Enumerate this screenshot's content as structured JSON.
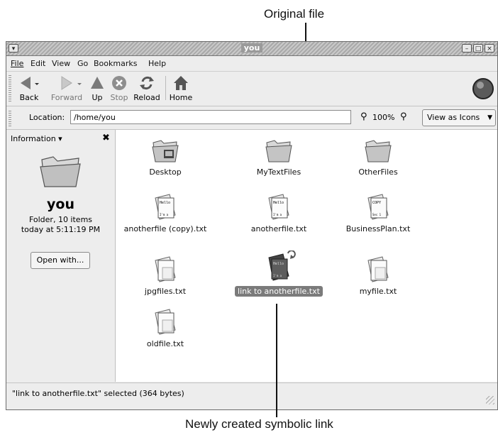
{
  "annotations": {
    "original_file": "Original file",
    "symbolic_link": "Newly created symbolic link"
  },
  "window": {
    "title": "you"
  },
  "menu": [
    "File",
    "Edit",
    "View",
    "Go",
    "Bookmarks",
    "Help"
  ],
  "toolbar": {
    "back": "Back",
    "forward": "Forward",
    "up": "Up",
    "stop": "Stop",
    "reload": "Reload",
    "home": "Home"
  },
  "location": {
    "label": "Location:",
    "value": "/home/you",
    "zoom": "100%",
    "view_mode": "View as Icons"
  },
  "sidebar": {
    "header": "Information",
    "folder_name": "you",
    "folder_info": "Folder, 10 items",
    "modified": "today at 5:11:19 PM",
    "open_with": "Open with..."
  },
  "files": [
    {
      "name": "Desktop",
      "kind": "folder-desktop"
    },
    {
      "name": "MyTextFiles",
      "kind": "folder"
    },
    {
      "name": "OtherFiles",
      "kind": "folder"
    },
    {
      "name": "anotherfile (copy).txt",
      "kind": "text-hello"
    },
    {
      "name": "anotherfile.txt",
      "kind": "text-hello"
    },
    {
      "name": "BusinessPlan.txt",
      "kind": "text-copy"
    },
    {
      "name": "jpgfiles.txt",
      "kind": "blank"
    },
    {
      "name": "link to anotherfile.txt",
      "kind": "link",
      "selected": true
    },
    {
      "name": "myfile.txt",
      "kind": "blank"
    },
    {
      "name": "oldfile.txt",
      "kind": "blank"
    }
  ],
  "status": "\"link to anotherfile.txt\" selected (364 bytes)",
  "colors": {
    "selection": "#7b7b7b",
    "window_bg": "#ededed"
  }
}
